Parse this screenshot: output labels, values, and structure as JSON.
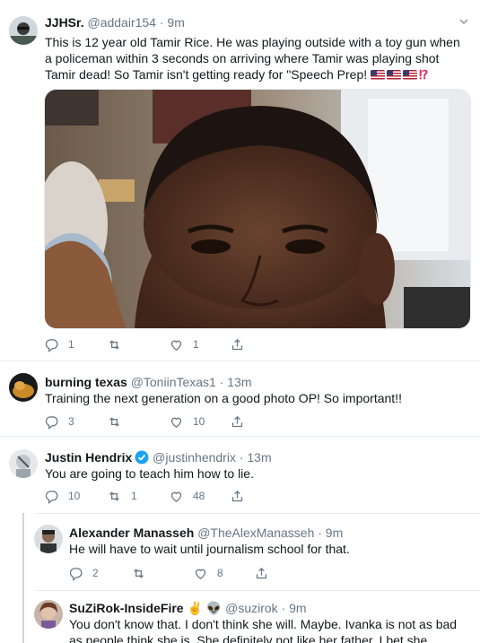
{
  "tweets": [
    {
      "name": "JJHSr.",
      "handle": "@addair154",
      "time": "· 9m",
      "text": "This is 12 year old Tamir Rice. He was playing outside with a toy gun when a policeman within 3 seconds on arriving where Tamir was playing shot Tamir dead! So Tamir isn't getting ready for \"Speech Prep! 🇺🇸🇺🇸🇺🇸⁉️",
      "text_main": "This is 12 year old Tamir Rice. He was playing outside with a toy gun when a policeman within 3 seconds on arriving where Tamir was playing shot Tamir dead! So Tamir isn't getting ready for \"Speech Prep!",
      "replies": "1",
      "retweets": "",
      "likes": "1"
    },
    {
      "name": "burning texas",
      "handle": "@ToniinTexas1",
      "time": "· 13m",
      "text": "Training the next generation on a good photo OP! So important!!",
      "replies": "3",
      "retweets": "",
      "likes": "10"
    },
    {
      "name": "Justin Hendrix",
      "handle": "@justinhendrix",
      "time": "· 13m",
      "text": "You are going to teach him how to lie.",
      "replies": "10",
      "retweets": "1",
      "likes": "48"
    },
    {
      "name": "Alexander Manasseh",
      "handle": "@TheAlexManasseh",
      "time": "· 9m",
      "text": "He will have to wait until journalism school for that.",
      "replies": "2",
      "retweets": "",
      "likes": "8"
    },
    {
      "name": "SuZiRok-InsideFire",
      "name_emoji": "✌️ 👽",
      "handle": "@suzirok",
      "time": "· 9m",
      "text": "You don't know that. I don't think she will. Maybe. Ivanka is not as bad as people think she is. She definitely not like her father. I bet she cringes too"
    }
  ],
  "colors": {
    "text": "#14171a",
    "secondary": "#657786",
    "verified": "#1da1f2",
    "thread_line": "#ccd6dd",
    "divider": "#e6ecf0"
  },
  "icons": [
    "reply-icon",
    "retweet-icon",
    "like-icon",
    "share-icon",
    "chevron-down-icon",
    "verified-badge-icon"
  ]
}
